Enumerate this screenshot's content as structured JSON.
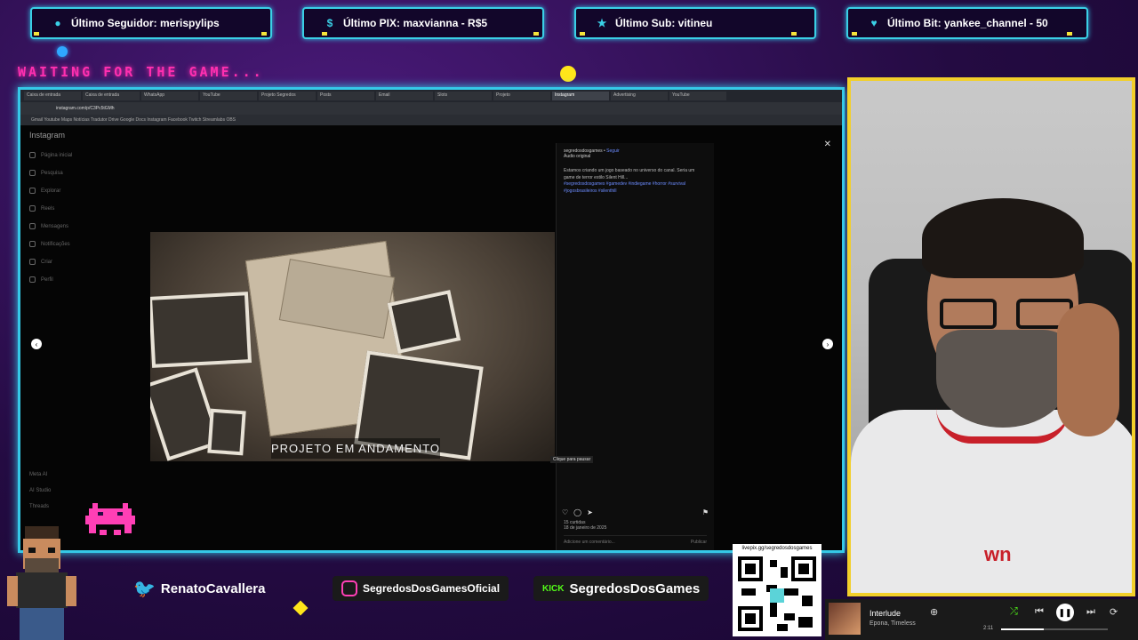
{
  "alerts": [
    {
      "icon": "person-icon",
      "text": "Último Seguidor: merispylips"
    },
    {
      "icon": "dollar-icon",
      "text": "Último PIX: maxvianna - R$5"
    },
    {
      "icon": "star-icon",
      "text": "Último Sub: vitineu"
    },
    {
      "icon": "heart-icon",
      "text": "Último Bit: yankee_channel - 50"
    }
  ],
  "waiting_text": "WAITING FOR THE GAME...",
  "browser": {
    "tabs": [
      "Caixa de entrada",
      "Caixa de entrada",
      "WhatsApp",
      "YouTube",
      "Projeto Segredos",
      "Posts",
      "Email",
      "Slots",
      "Projeto",
      "Instagram",
      "Advertising",
      "YouTube"
    ],
    "url": "instagram.com/p/C3Pc5tGMh",
    "bookmarks": "Gmail  Youtube  Maps  Notícias  Tradutor  Drive  Google Docs  Instagram  Facebook  Twitch  Streamlabs  OBS"
  },
  "instagram": {
    "logo": "Instagram",
    "nav": [
      "Página inicial",
      "Pesquisa",
      "Explorar",
      "Reels",
      "Mensagens",
      "Notificações",
      "Criar",
      "Perfil"
    ],
    "bottom": [
      "Meta AI",
      "AI Studio",
      "Threads"
    ],
    "post_caption": "PROJETO EM ANDAMENTO",
    "account": "segredosdosgames",
    "follow_label": "Seguir",
    "audio_label": "Áudio original",
    "caption_body": "Estamos criando um jogo baseado no universo do canal. Seria um game de terror estilo Silent Hill...",
    "hashtags": "#segredosdosgames #gamedev #indiegame #horror #survival #jogosbrasileiros #silenthill",
    "likes": "15 curtidas",
    "date": "18 de janeiro de 2025",
    "comment_placeholder": "Adicione um comentário...",
    "publish_label": "Publicar",
    "tooltip": "Clique para pausar"
  },
  "socials": [
    {
      "icon": "twitter-icon",
      "handle": "RenatoCavallera"
    },
    {
      "icon": "instagram-icon",
      "handle": "SegredosDosGamesOficial"
    },
    {
      "icon": "kick-icon",
      "badge": "KICK",
      "handle": "SegredosDosGames"
    }
  ],
  "qr": {
    "url": "livepix.gg/segredosdosgames"
  },
  "player": {
    "track": "Interlude",
    "artist": "Epona, Timeless",
    "elapsed": "2:11"
  }
}
